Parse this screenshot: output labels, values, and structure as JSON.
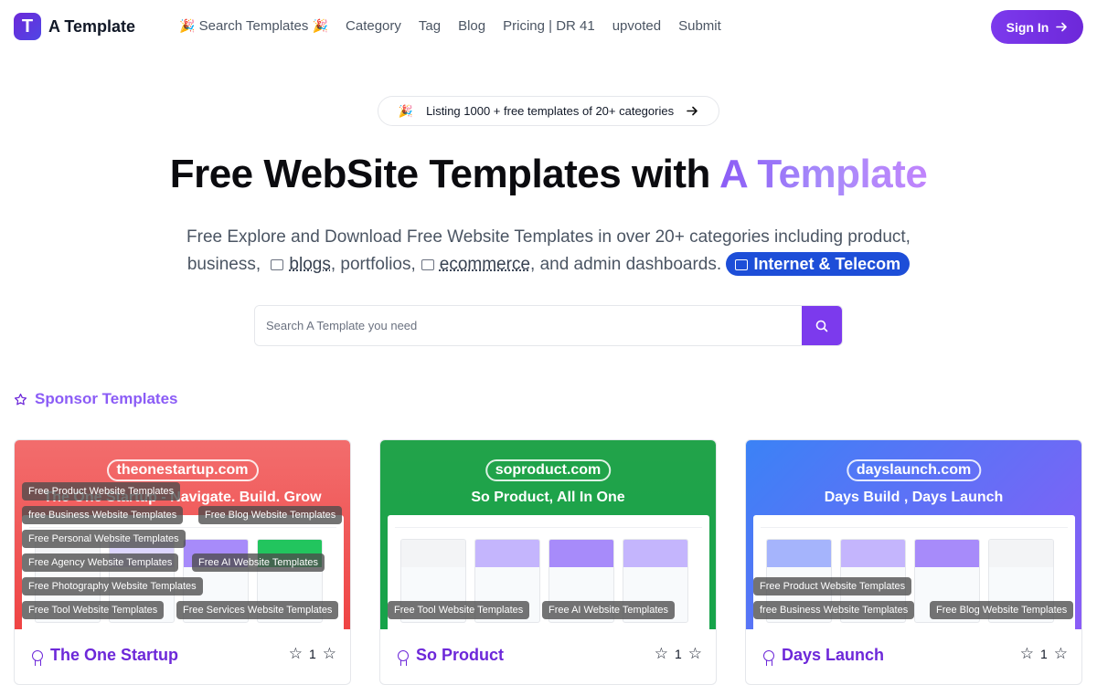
{
  "header": {
    "logo_letter": "T",
    "logo_text": "A Template",
    "nav": [
      "Search Templates",
      "Category",
      "Tag",
      "Blog",
      "Pricing | DR 41",
      "upvoted",
      "Submit"
    ],
    "signin_label": "Sign In"
  },
  "hero": {
    "pill_text": "Listing 1000 + free templates of 20+ categories",
    "title_main": "Free WebSite Templates with ",
    "title_accent": "A Template",
    "subtitle_part1": "Free Explore and Download Free Website Templates in over 20+ categories including product,",
    "subtitle_part2": "business,",
    "subtitle_link1": "blogs",
    "subtitle_part3": ", portfolios,",
    "subtitle_link2": "ecommerce",
    "subtitle_part4": ", and admin dashboards.",
    "chip_label": "Internet & Telecom"
  },
  "search": {
    "placeholder": "Search A Template you need"
  },
  "sponsor": {
    "heading": "Sponsor Templates"
  },
  "cards": [
    {
      "domain": "theonestartup.com",
      "tagline": "The One Startup - Navigate. Build. Grow",
      "title": "The One Startup",
      "votes": "1",
      "bg": "#ef4444",
      "tags": [
        "Free Product Website Templates",
        "free Business Website Templates",
        "Free Blog Website Templates",
        "Free Personal Website Templates",
        "Free Agency Website Templates",
        "Free AI Website Templates",
        "Free Photography Website Templates",
        "Free Tool Website Templates",
        "Free Services Website Templates"
      ]
    },
    {
      "domain": "soproduct.com",
      "tagline": "So Product, All In One",
      "title": "So Product",
      "votes": "1",
      "bg": "#16a34a",
      "tags": [
        "Free Tool Website Templates",
        "Free AI Website Templates"
      ]
    },
    {
      "domain": "dayslaunch.com",
      "tagline": "Days Build , Days Launch",
      "title": "Days Launch",
      "votes": "1",
      "bg": "#6366f1",
      "tags": [
        "Free Product Website Templates",
        "free Business Website Templates",
        "Free Blog Website Templates"
      ]
    }
  ],
  "colors": {
    "accent": "#7c3aed",
    "chip": "#1d4ed8"
  }
}
